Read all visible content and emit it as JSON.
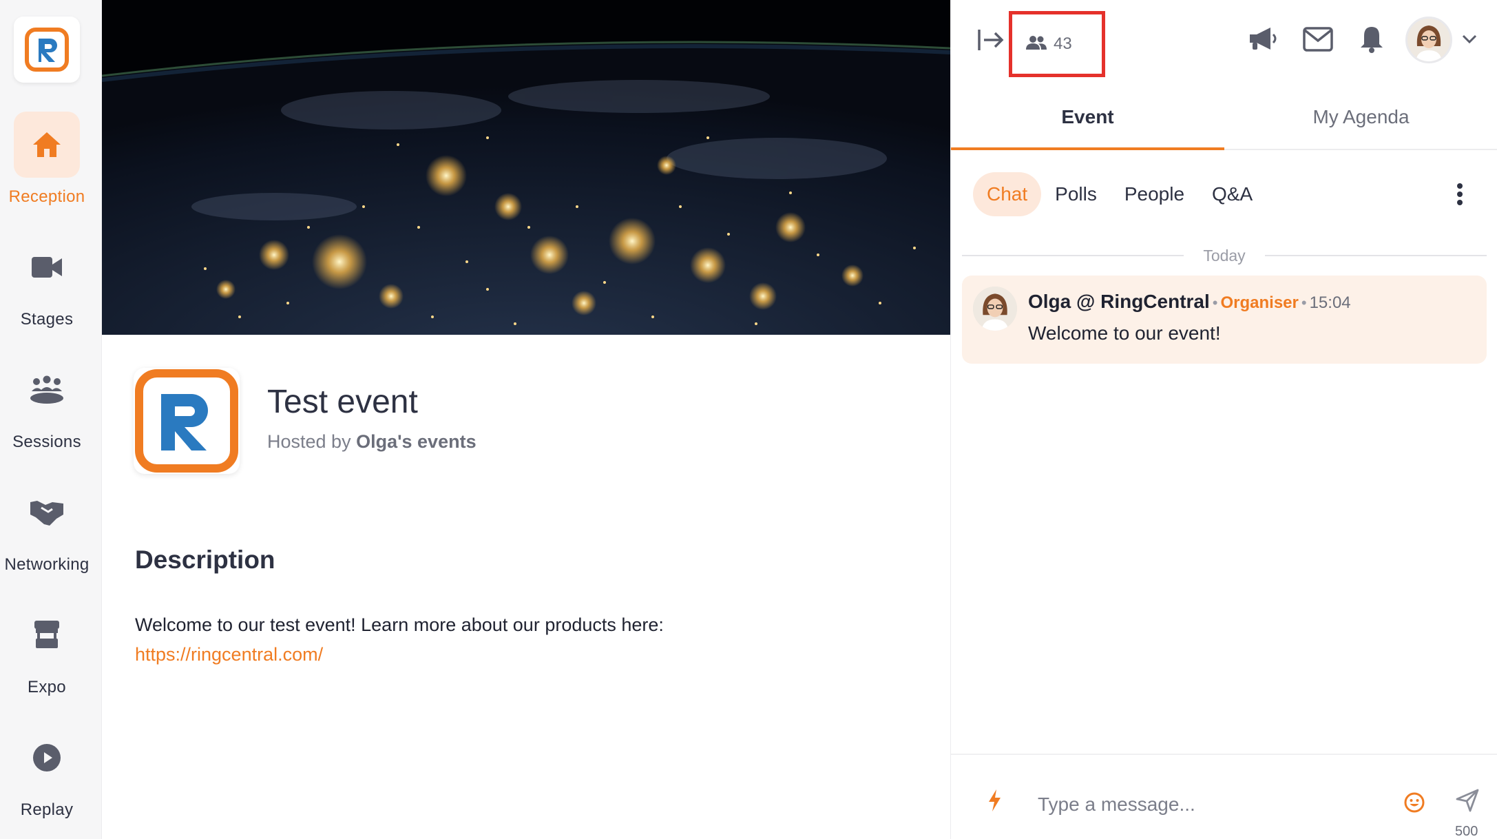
{
  "sidebar": {
    "items": [
      {
        "label": "Reception",
        "icon": "home-icon",
        "active": true
      },
      {
        "label": "Stages",
        "icon": "video-camera-icon"
      },
      {
        "label": "Sessions",
        "icon": "group-icon"
      },
      {
        "label": "Networking",
        "icon": "handshake-icon"
      },
      {
        "label": "Expo",
        "icon": "booth-icon"
      },
      {
        "label": "Replay",
        "icon": "play-icon"
      }
    ]
  },
  "event": {
    "title": "Test event",
    "hosted_prefix": "Hosted by",
    "host": "Olga's events",
    "description_heading": "Description",
    "description_text": "Welcome to our test event! Learn more about our products here:",
    "link": "https://ringcentral.com/"
  },
  "panel": {
    "attendee_count": "43",
    "main_tabs": [
      "Event",
      "My Agenda"
    ],
    "sub_tabs": [
      "Chat",
      "Polls",
      "People",
      "Q&A"
    ],
    "day_separator": "Today",
    "message": {
      "author": "Olga @ RingCentral",
      "role": "Organiser",
      "time": "15:04",
      "text": "Welcome to our event!"
    },
    "composer": {
      "placeholder": "Type a message...",
      "char_limit": "500"
    }
  },
  "colors": {
    "accent": "#f07c22",
    "brand_blue": "#2a7ac0",
    "highlight_box": "#e5312b"
  }
}
